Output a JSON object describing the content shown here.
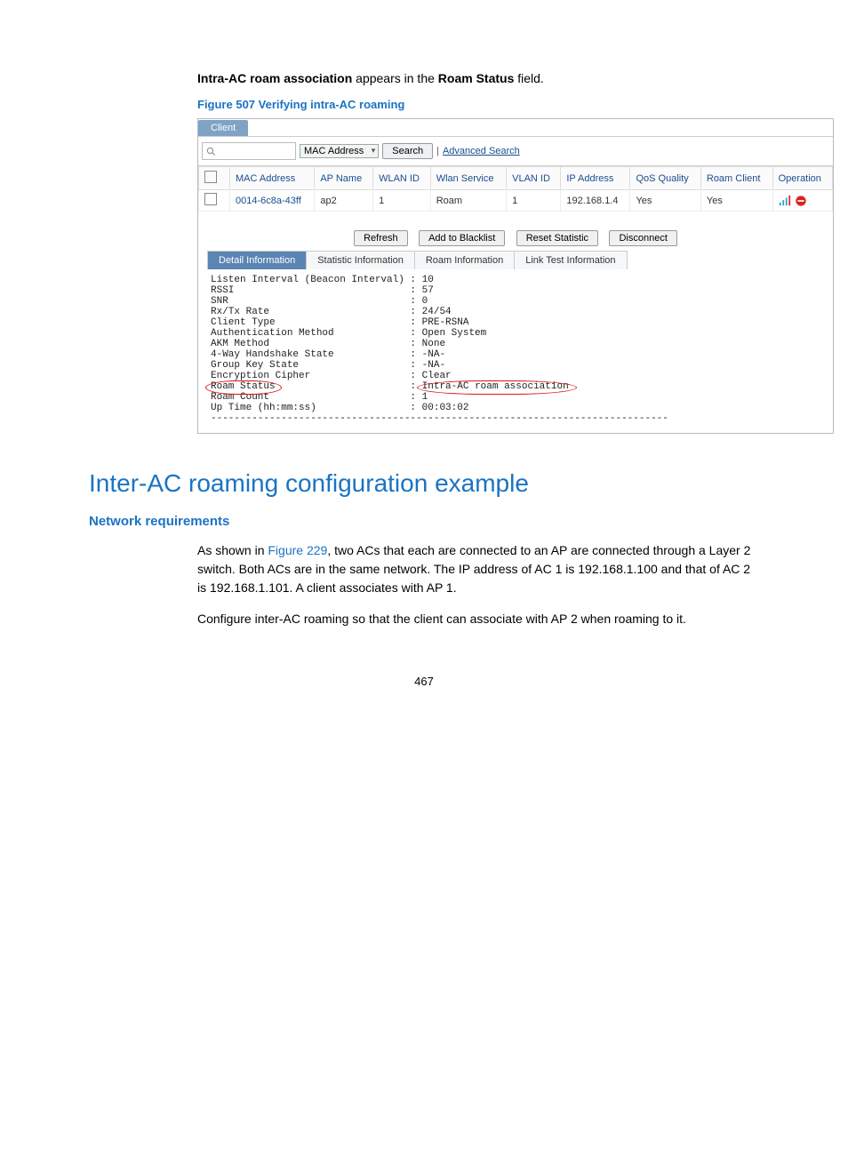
{
  "intro": {
    "bold1": "Intra-AC roam association",
    "middle": " appears in the ",
    "bold2": "Roam Status",
    "end": " field."
  },
  "figcap": "Figure 507 Verifying intra-AC roaming",
  "screenshot": {
    "tab": "Client",
    "search_field_label": "MAC Address",
    "search_button": "Search",
    "advanced": "Advanced Search",
    "headers": {
      "mac": "MAC Address",
      "ap": "AP Name",
      "wlan": "WLAN ID",
      "service": "Wlan Service",
      "vlan": "VLAN ID",
      "ip": "IP Address",
      "qos": "QoS Quality",
      "roam": "Roam Client",
      "op": "Operation"
    },
    "row": {
      "mac": "0014-6c8a-43ff",
      "ap": "ap2",
      "wlan": "1",
      "service": "Roam",
      "vlan": "1",
      "ip": "192.168.1.4",
      "qos": "Yes",
      "roam": "Yes"
    },
    "actions": {
      "refresh": "Refresh",
      "addbl": "Add to Blacklist",
      "reset": "Reset Statistic",
      "disc": "Disconnect"
    },
    "subtabs": {
      "detail": "Detail Information",
      "stat": "Statistic Information",
      "roam": "Roam Information",
      "link": "Link Test Information"
    },
    "detail_lines": [
      "Listen Interval (Beacon Interval) : 10",
      "RSSI                              : 57",
      "SNR                               : 0",
      "Rx/Tx Rate                        : 24/54",
      "Client Type                       : PRE-RSNA",
      "Authentication Method             : Open System",
      "AKM Method                        : None",
      "4-Way Handshake State             : -NA-",
      "Group Key State                   : -NA-",
      "Encryption Cipher                 : Clear"
    ],
    "roam_status_label": "Roam Status",
    "roam_status_sep": "                       : ",
    "roam_status_value": "Intra-AC roam association",
    "detail_tail": [
      "Roam Count                        : 1",
      "Up Time (hh:mm:ss)                : 00:03:02",
      "------------------------------------------------------------------------------"
    ]
  },
  "section_title": "Inter-AC roaming configuration example",
  "subhead": "Network requirements",
  "para1_prefix": "As shown in ",
  "para1_link": "Figure 229",
  "para1_rest": ", two ACs that each are connected to an AP are connected through a Layer 2 switch. Both ACs are in the same network. The IP address of AC 1 is 192.168.1.100 and that of AC 2 is 192.168.1.101. A client associates with AP 1.",
  "para2": "Configure inter-AC roaming so that the client can associate with AP 2 when roaming to it.",
  "pagenum": "467"
}
